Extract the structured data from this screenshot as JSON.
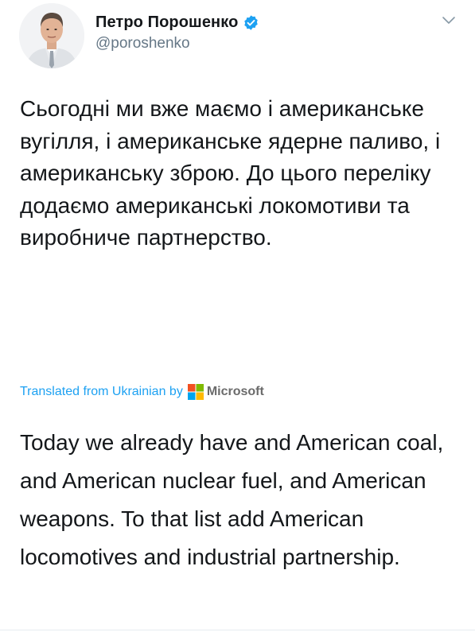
{
  "tweet": {
    "author": {
      "display_name": "Петро Порошенко",
      "handle": "@poroshenko",
      "verified": true
    },
    "original_text": "Сьогодні ми вже маємо і американське вугілля, і американське ядерне паливо, і американську зброю. До цього переліку додаємо американські локомотиви та виробниче партнерство.",
    "translation": {
      "label": "Translated from Ukrainian by",
      "provider": "Microsoft",
      "text": "Today we already have and American coal, and American nuclear fuel, and American weapons. To that list add American locomotives and industrial partnership."
    }
  },
  "colors": {
    "link_blue": "#1da1f2",
    "verified_blue": "#1da1f2",
    "secondary_text": "#657786",
    "ms_red": "#f25022",
    "ms_green": "#7fba00",
    "ms_blue": "#00a4ef",
    "ms_yellow": "#ffb900"
  },
  "icons": {
    "verified": "verified-badge-icon",
    "menu": "chevron-down-icon",
    "provider_logo": "microsoft-logo-icon"
  }
}
